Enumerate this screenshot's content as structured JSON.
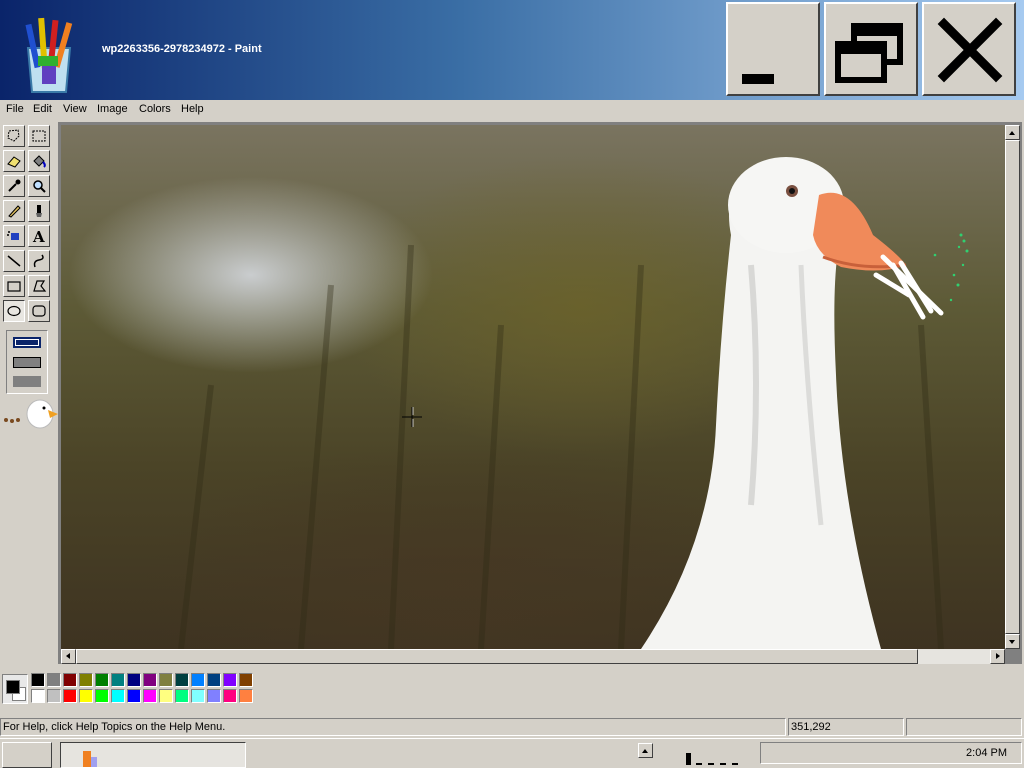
{
  "window": {
    "title": "wp2263356-2978234972 - Paint",
    "app_icon": "paint-brushes-icon",
    "minimize_icon": "minimize-icon",
    "restore_icon": "restore-icon",
    "close_icon": "close-icon"
  },
  "menu": {
    "items": [
      {
        "label": "File"
      },
      {
        "label": "Edit"
      },
      {
        "label": "View"
      },
      {
        "label": "Image"
      },
      {
        "label": "Colors"
      },
      {
        "label": "Help"
      }
    ]
  },
  "toolbox": {
    "tools": [
      {
        "name": "free-form-select",
        "icon": "free-form-select-icon"
      },
      {
        "name": "select",
        "icon": "rect-select-icon"
      },
      {
        "name": "eraser",
        "icon": "eraser-icon"
      },
      {
        "name": "fill-with-color",
        "icon": "paint-bucket-icon"
      },
      {
        "name": "pick-color",
        "icon": "eyedropper-icon"
      },
      {
        "name": "magnifier",
        "icon": "magnifier-icon"
      },
      {
        "name": "pencil",
        "icon": "pencil-icon"
      },
      {
        "name": "brush",
        "icon": "brush-icon"
      },
      {
        "name": "airbrush",
        "icon": "airbrush-icon"
      },
      {
        "name": "text",
        "icon": "text-icon",
        "glyph": "A"
      },
      {
        "name": "line",
        "icon": "line-icon"
      },
      {
        "name": "curve",
        "icon": "curve-icon"
      },
      {
        "name": "rectangle",
        "icon": "rectangle-icon"
      },
      {
        "name": "polygon",
        "icon": "polygon-icon"
      },
      {
        "name": "ellipse",
        "icon": "ellipse-icon",
        "selected": true
      },
      {
        "name": "rounded-rectangle",
        "icon": "rounded-rectangle-icon"
      }
    ],
    "fill_styles": [
      "outline",
      "outline-fill",
      "fill"
    ],
    "selected_fill_style": "outline"
  },
  "palette": {
    "foreground": "#000000",
    "background": "#ffffff",
    "top_row": [
      "#000000",
      "#808080",
      "#800000",
      "#808000",
      "#008000",
      "#008080",
      "#000080",
      "#800080",
      "#808040",
      "#004040",
      "#0080ff",
      "#004080",
      "#8000ff",
      "#804000"
    ],
    "bottom_row": [
      "#ffffff",
      "#c0c0c0",
      "#ff0000",
      "#ffff00",
      "#00ff00",
      "#00ffff",
      "#0000ff",
      "#ff00ff",
      "#ffff80",
      "#00ff80",
      "#80ffff",
      "#8080ff",
      "#ff0080",
      "#ff8040"
    ]
  },
  "status": {
    "help_text": "For Help, click Help Topics on the Help Menu.",
    "coordinates": "351,292",
    "size": ""
  },
  "taskbar": {
    "clock": "2:04 PM"
  }
}
